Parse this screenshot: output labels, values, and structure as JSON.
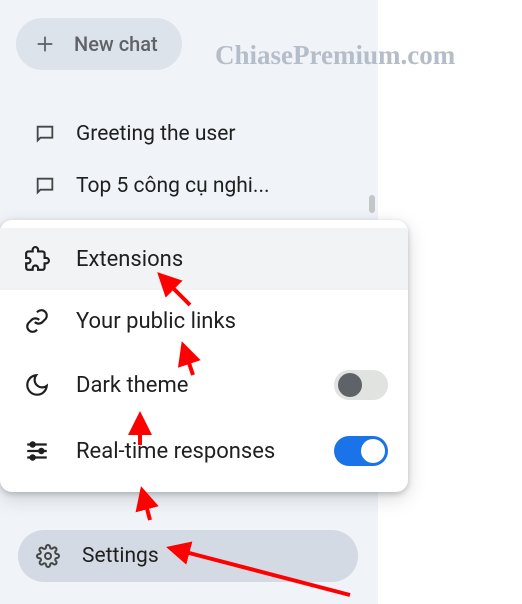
{
  "watermark": "ChiasePremium.com",
  "sidebar": {
    "new_chat_label": "New chat",
    "recent": [
      {
        "label": "Greeting the user"
      },
      {
        "label": "Top 5 công cụ nghi..."
      }
    ],
    "settings_label": "Settings"
  },
  "menu": {
    "items": [
      {
        "label": "Extensions"
      },
      {
        "label": "Your public links"
      },
      {
        "label": "Dark theme",
        "toggle": false
      },
      {
        "label": "Real-time responses",
        "toggle": true
      }
    ]
  }
}
